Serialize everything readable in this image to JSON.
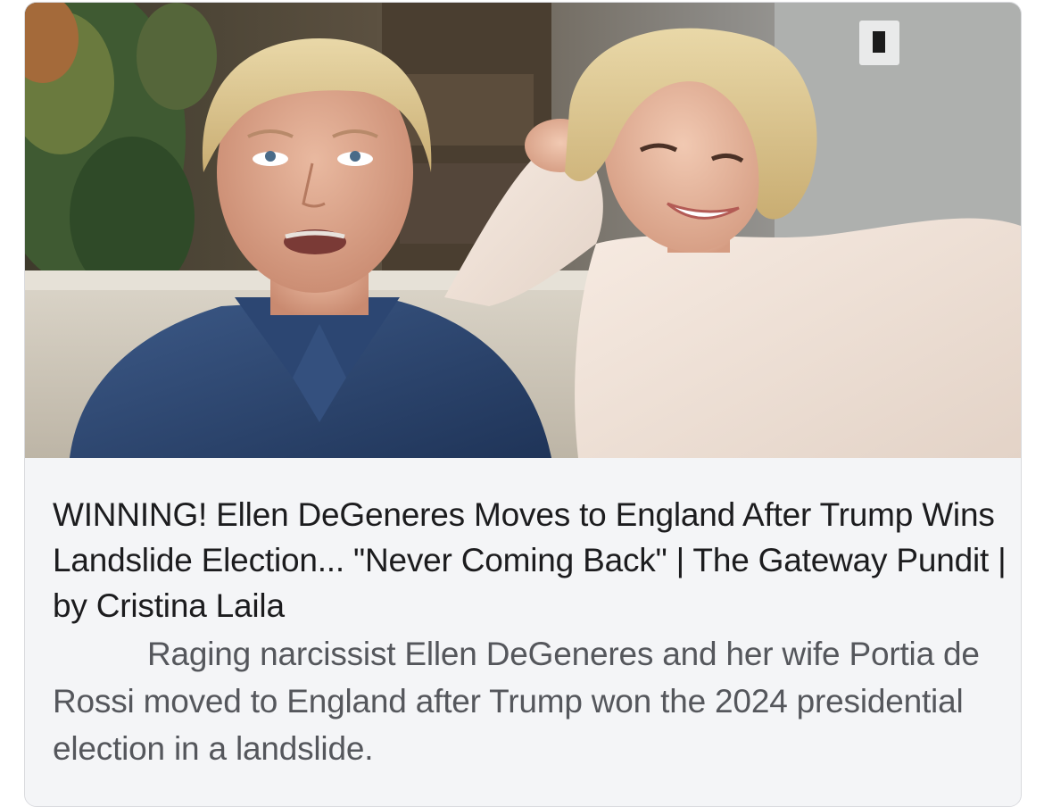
{
  "link_preview": {
    "image_alt": "Ellen DeGeneres and Portia de Rossi seated on a couch",
    "headline": "WINNING! Ellen DeGeneres Moves to England After Trump Wins Landslide Election... \"Never Coming Back\" | The Gateway Pundit | by Cristina Laila",
    "summary": "Raging narcissist Ellen DeGeneres and her wife Portia de Rossi moved to England after Trump won the 2024 presidential election in a landslide."
  },
  "colors": {
    "card_background": "#f4f5f7",
    "headline_text": "#1c1c1e",
    "summary_text": "#55575c",
    "card_border": "#d9dade"
  }
}
